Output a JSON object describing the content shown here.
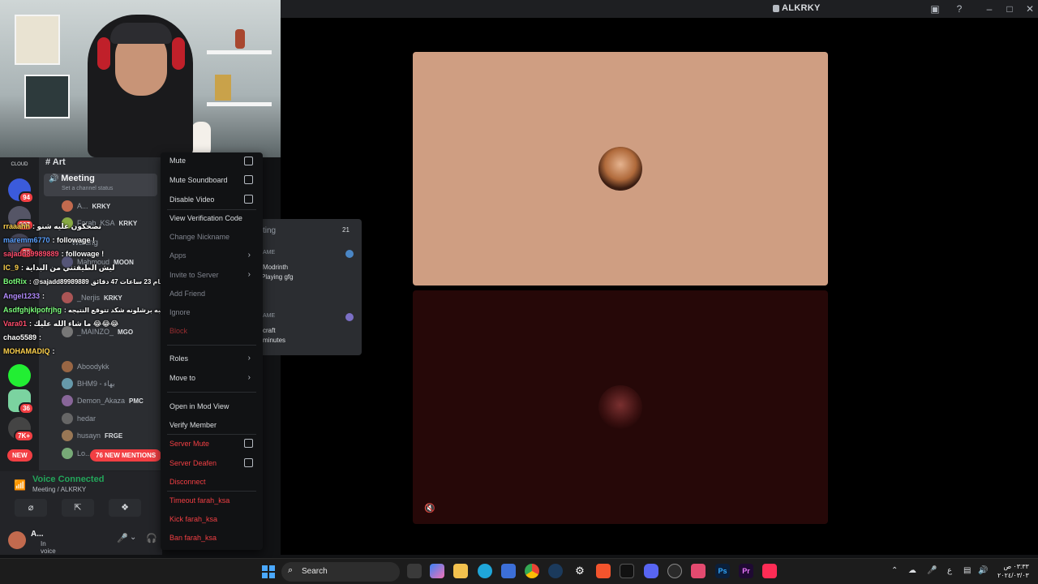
{
  "window": {
    "title": "ALKRKY"
  },
  "channels": {
    "art": "Art",
    "meeting": "Meeting",
    "channel_status": "Set a channel status",
    "waiting": "Waiting",
    "members": [
      {
        "name": "A...",
        "tag": "KRKY"
      },
      {
        "name": "Farah_KSA",
        "tag": "KRKY"
      },
      {
        "name": "Mahmoud",
        "tag": "MOON"
      },
      {
        "name": "_Nerjis",
        "tag": "KRKY"
      },
      {
        "name": "_MAINZO_",
        "tag": "MGO"
      },
      {
        "name": "Aboodykk",
        "tag": ""
      },
      {
        "name": "BHM9 - بهاء",
        "tag": ""
      },
      {
        "name": "Demon_Akaza",
        "tag": "PMC"
      },
      {
        "name": "hedar",
        "tag": ""
      },
      {
        "name": "husayn",
        "tag": "FRGE"
      },
      {
        "name": "Lo...",
        "tag": ""
      }
    ],
    "mentions": "76 NEW MENTIONS",
    "new_badge": "NEW"
  },
  "servers": {
    "badges": [
      "94",
      "207",
      "22",
      "36",
      "7K+"
    ],
    "cloud_label": "CLOUD"
  },
  "voice": {
    "status": "Voice Connected",
    "location": "Meeting / ALKRKY"
  },
  "user": {
    "name": "A...",
    "status": "In voice"
  },
  "chat": [
    {
      "name": "rraaahh",
      "color": "#ffd34d",
      "msg": ": تضحكون عليه شنو"
    },
    {
      "name": "maremm6770",
      "color": "#5aa0ff",
      "msg": ": followage !"
    },
    {
      "name": "sajadd89989889",
      "color": "#ff4d6d",
      "msg": ": followage !"
    },
    {
      "name": "IC_9",
      "color": "#ffd34d",
      "msg": ": ليش الطيقتني من البداية"
    },
    {
      "name": "BotRix",
      "color": "#7cff7c",
      "msg": ": @sajadd89989889 يتابع هذه القناة ل 1 أشهر 19 أيام 23 ساعات 47 دقائق !"
    },
    {
      "name": "Angel1233",
      "color": "#b48cff",
      "msg": ":"
    },
    {
      "name": "Asdfghjklpofrjhg",
      "color": "#7cff7c",
      "msg": ": باجر لعبه برشلونه شكد تتوقع النتيجه"
    },
    {
      "name": "Vara01",
      "color": "#ff4d6d",
      "msg": ": ما شاء الله عليك 😂😂😂"
    },
    {
      "name": "chao5589",
      "color": "#ffffff",
      "msg": ":"
    },
    {
      "name": "MOHAMADIQ",
      "color": "#ffd34d",
      "msg": ":"
    }
  ],
  "context_menu": {
    "items": [
      {
        "label": "Mute",
        "kind": "check"
      },
      {
        "label": "Mute Soundboard",
        "kind": "check"
      },
      {
        "label": "Disable Video",
        "kind": "check"
      },
      {
        "label": "View Verification Code",
        "kind": "plain"
      },
      {
        "label": "Change Nickname",
        "kind": "plain"
      },
      {
        "label": "Apps",
        "kind": "sub"
      },
      {
        "label": "Invite to Server",
        "kind": "sub"
      },
      {
        "label": "Add Friend",
        "kind": "plain"
      },
      {
        "label": "Ignore",
        "kind": "plain"
      },
      {
        "label": "Block",
        "kind": "danger"
      },
      {
        "label": "Roles",
        "kind": "sub"
      },
      {
        "label": "Move to",
        "kind": "sub"
      },
      {
        "label": "Open in Mod View",
        "kind": "plain"
      },
      {
        "label": "Verify Member",
        "kind": "plain"
      },
      {
        "label": "Server Mute",
        "kind": "danger-check"
      },
      {
        "label": "Server Deafen",
        "kind": "danger-check"
      },
      {
        "label": "Disconnect",
        "kind": "danger"
      },
      {
        "label": "Timeout farah_ksa",
        "kind": "danger"
      },
      {
        "label": "Kick farah_ksa",
        "kind": "danger"
      },
      {
        "label": "Ban farah_ksa",
        "kind": "danger"
      }
    ]
  },
  "activity_popup": {
    "header": "ting",
    "count": "21",
    "game_label_1": "AME",
    "app_1": "Modrinth",
    "app_1_sub": "Playing gfg",
    "game_label_2": "AME",
    "app_2": "craft",
    "app_2_sub": "minutes"
  },
  "taskbar": {
    "search": "Search",
    "clock_time": "٠٣:٣٣ ص",
    "clock_date": "٢٠٢٤/٠٣/٠٣"
  }
}
